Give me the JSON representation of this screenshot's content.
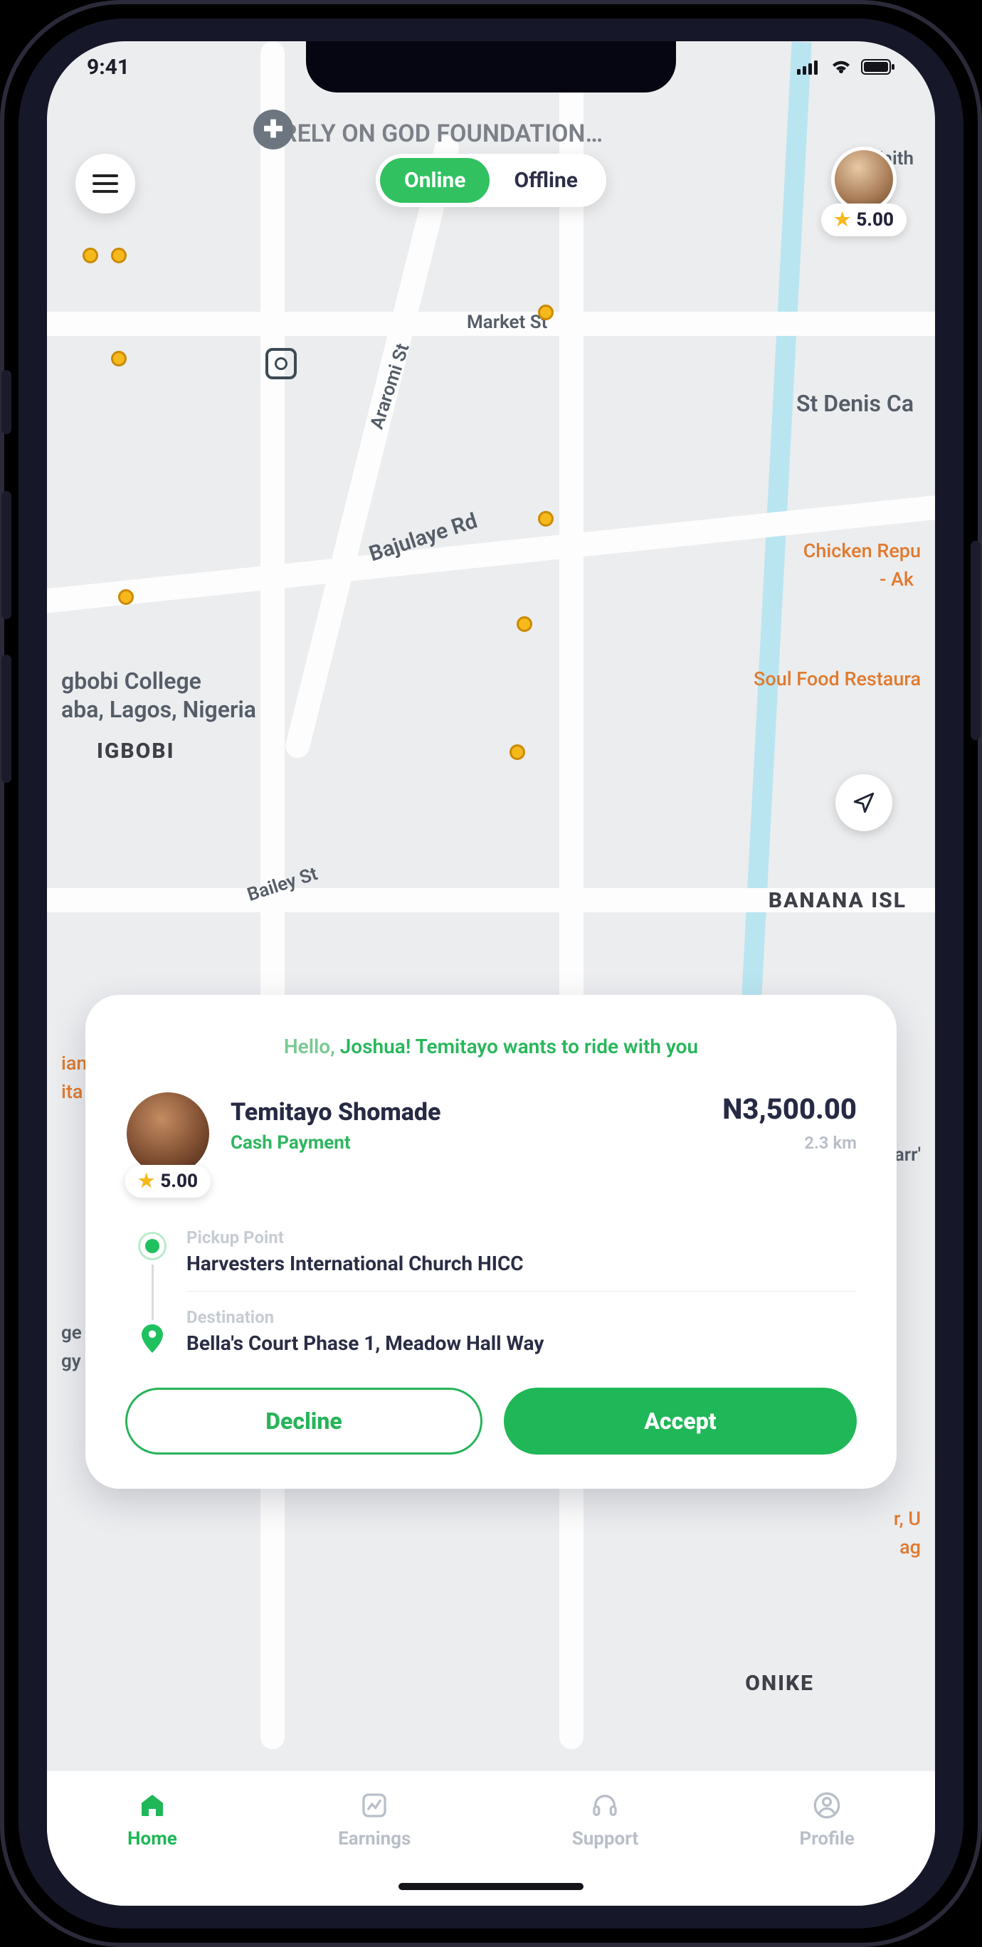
{
  "status": {
    "time": "9:41"
  },
  "toggle": {
    "online": "Online",
    "offline": "Offline"
  },
  "driver_rating": "5.00",
  "map": {
    "top_place": "RELY ON GOD FOUNDATION…",
    "faith": "Faith",
    "market": "Market St",
    "araromi": "Araromi St",
    "bajulaye": "Bajulaye Rd",
    "bailey": "Bailey St",
    "stdenis": "St Denis Ca",
    "chicken": "Chicken Repu",
    "chicken2": "- Ak",
    "soul": "Soul Food Restaura",
    "ian": "ian",
    "ita": "ita",
    "arr": "arr'",
    "rU": "r, U",
    "ag": "ag",
    "ge": "ge",
    "gy": "gy",
    "college1": "gbobi College",
    "college2": "aba, Lagos, Nigeria",
    "igbobi": "IGBOBI",
    "banana": "BANANA ISL",
    "onike": "ONIKE"
  },
  "card": {
    "hello": "Hello,",
    "greet_rest": " Joshua! Temitayo wants to ride with you",
    "rider_name": "Temitayo Shomade",
    "payment": "Cash Payment",
    "rider_rating": "5.00",
    "fare": "N3,500.00",
    "distance": "2.3 km",
    "pickup_label": "Pickup Point",
    "pickup_value": "Harvesters International Church HICC",
    "dest_label": "Destination",
    "dest_value": "Bella's Court Phase 1, Meadow Hall Way",
    "decline": "Decline",
    "accept": "Accept"
  },
  "tabs": {
    "home": "Home",
    "earnings": "Earnings",
    "support": "Support",
    "profile": "Profile"
  }
}
